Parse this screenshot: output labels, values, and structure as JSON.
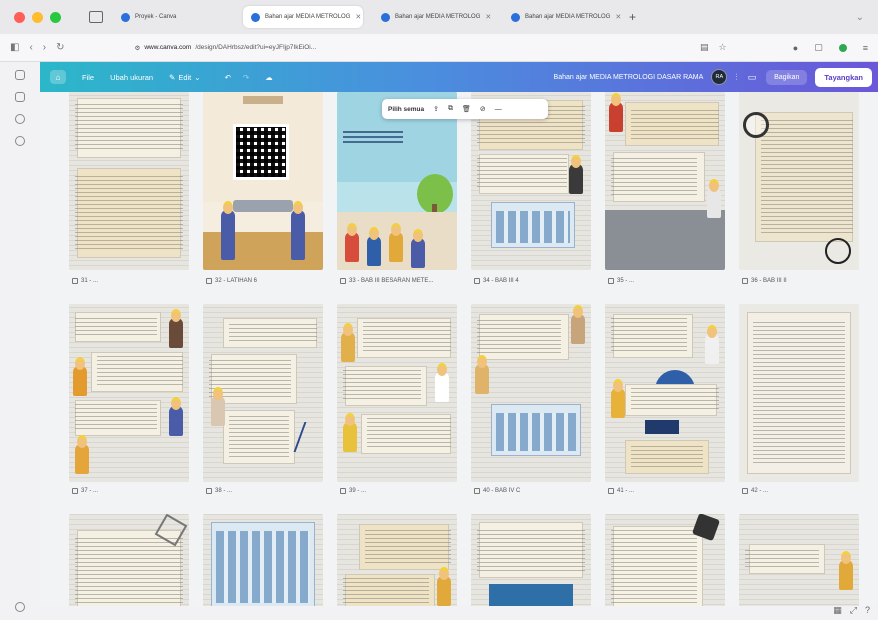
{
  "browser": {
    "tabs": [
      {
        "label": "Proyek - Canva",
        "active": false
      },
      {
        "label": "Bahan ajar MEDIA METROLOG",
        "active": true
      },
      {
        "label": "Bahan ajar MEDIA METROLOG",
        "active": false
      },
      {
        "label": "Bahan ajar MEDIA METROLOG",
        "active": false
      }
    ],
    "url_domain": "www.canva.com",
    "url_path": "/design/DAHrbsz/edit?ui=eyJFIjp7IkEiOi..."
  },
  "canva_header": {
    "file_label": "File",
    "resize_label": "Ubah ukuran",
    "edit_label": "Edit",
    "doc_title": "Bahan ajar MEDIA METROLOGI DASAR RAMA",
    "avatar_initials": "RA",
    "share_label": "Bagikan",
    "present_label": "Tayangkan"
  },
  "floating_toolbar": {
    "select_all_label": "Pilih semua"
  },
  "pages": [
    {
      "label": "31 - ..."
    },
    {
      "label": "32 - LATIHAN 6"
    },
    {
      "label": "33 - BAB III BESARAN METE..."
    },
    {
      "label": "34 - BAB III 4"
    },
    {
      "label": "35 - ..."
    },
    {
      "label": "36 - BAB III II"
    },
    {
      "label": "37 - ..."
    },
    {
      "label": "38 - ..."
    },
    {
      "label": "39 - ..."
    },
    {
      "label": "40 - BAB IV C"
    },
    {
      "label": "41 - ..."
    },
    {
      "label": "42 - ..."
    }
  ],
  "colors": {
    "header_start": "#2bb7c9",
    "header_end": "#6a57d9",
    "present_text": "#5a3fc7"
  }
}
